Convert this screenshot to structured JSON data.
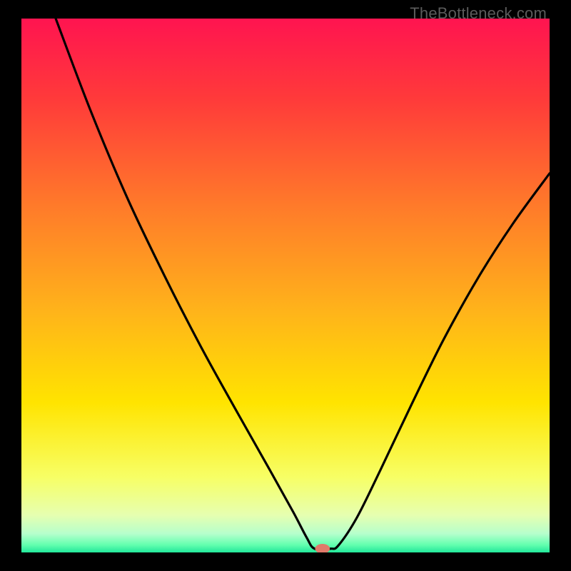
{
  "watermark": "TheBottleneck.com",
  "chart_data": {
    "type": "line",
    "title": "",
    "xlabel": "",
    "ylabel": "",
    "xlim": [
      0,
      100
    ],
    "ylim": [
      0,
      100
    ],
    "grid": false,
    "legend": false,
    "gradient_stops": [
      {
        "offset": 0.0,
        "color": "#ff1450"
      },
      {
        "offset": 0.15,
        "color": "#ff3a3a"
      },
      {
        "offset": 0.35,
        "color": "#ff7a2a"
      },
      {
        "offset": 0.55,
        "color": "#ffb41a"
      },
      {
        "offset": 0.72,
        "color": "#ffe400"
      },
      {
        "offset": 0.86,
        "color": "#f7ff66"
      },
      {
        "offset": 0.93,
        "color": "#e6ffb0"
      },
      {
        "offset": 0.965,
        "color": "#b6ffcc"
      },
      {
        "offset": 0.985,
        "color": "#66ffb0"
      },
      {
        "offset": 1.0,
        "color": "#22e89a"
      }
    ],
    "series": [
      {
        "name": "bottleneck-curve",
        "color": "#000000",
        "points": [
          {
            "x": 6.5,
            "y": 100.0
          },
          {
            "x": 13.0,
            "y": 83.0
          },
          {
            "x": 20.0,
            "y": 66.5
          },
          {
            "x": 27.0,
            "y": 52.0
          },
          {
            "x": 34.0,
            "y": 38.5
          },
          {
            "x": 41.0,
            "y": 26.0
          },
          {
            "x": 47.0,
            "y": 15.5
          },
          {
            "x": 51.5,
            "y": 7.5
          },
          {
            "x": 54.0,
            "y": 2.8
          },
          {
            "x": 55.5,
            "y": 0.7
          },
          {
            "x": 58.5,
            "y": 0.7
          },
          {
            "x": 60.0,
            "y": 1.3
          },
          {
            "x": 63.5,
            "y": 6.5
          },
          {
            "x": 68.0,
            "y": 15.5
          },
          {
            "x": 74.0,
            "y": 28.0
          },
          {
            "x": 80.0,
            "y": 40.0
          },
          {
            "x": 86.5,
            "y": 51.5
          },
          {
            "x": 93.0,
            "y": 61.5
          },
          {
            "x": 100.0,
            "y": 71.0
          }
        ]
      }
    ],
    "marker": {
      "name": "optimal-point",
      "x": 57.0,
      "y": 0.7,
      "color": "#e07a6a",
      "rx": 1.4,
      "ry": 0.9
    }
  }
}
